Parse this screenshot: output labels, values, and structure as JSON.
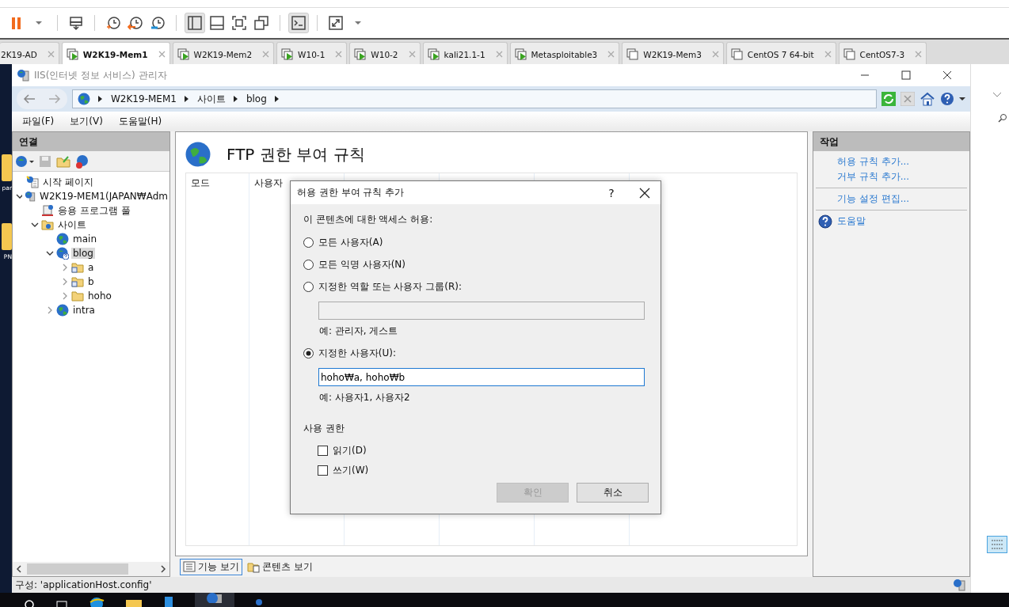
{
  "vm_tabs": [
    {
      "label": "2K19-AD",
      "selected": false
    },
    {
      "label": "W2K19-Mem1",
      "selected": true,
      "running": true
    },
    {
      "label": "W2K19-Mem2",
      "selected": false,
      "running": true
    },
    {
      "label": "W10-1",
      "selected": false,
      "running": true
    },
    {
      "label": "W10-2",
      "selected": false,
      "running": true
    },
    {
      "label": "kali21.1-1",
      "selected": false,
      "running": true
    },
    {
      "label": "Metasploitable3",
      "selected": false,
      "running": true
    },
    {
      "label": "W2K19-Mem3",
      "selected": false,
      "running": false
    },
    {
      "label": "CentOS 7 64-bit",
      "selected": false,
      "running": false
    },
    {
      "label": "CentOS7-3",
      "selected": false,
      "running": false
    }
  ],
  "desktop_labels": [
    "par",
    "PN"
  ],
  "iis": {
    "title": "IIS(인터넷 정보 서비스) 관리자",
    "breadcrumb": [
      "W2K19-MEM1",
      "사이트",
      "blog"
    ],
    "menu": [
      "파일(F)",
      "보기(V)",
      "도움말(H)"
    ],
    "connections": {
      "title": "연결",
      "tree": [
        {
          "label": "시작 페이지",
          "kind": "start",
          "selected": false
        },
        {
          "label": "W2K19-MEM1(JAPAN₩Adm",
          "kind": "server",
          "selected": false,
          "expanded": true,
          "children": [
            {
              "label": "응용 프로그램 풀",
              "kind": "pool",
              "selected": false
            },
            {
              "label": "사이트",
              "kind": "sites",
              "selected": false,
              "expanded": true,
              "children": [
                {
                  "label": "main",
                  "kind": "site",
                  "selected": false
                },
                {
                  "label": "blog",
                  "kind": "site_alert",
                  "selected": true,
                  "expanded": true,
                  "children": [
                    {
                      "label": "a",
                      "kind": "vdir",
                      "selected": false,
                      "expanded": false
                    },
                    {
                      "label": "b",
                      "kind": "vdir",
                      "selected": false,
                      "expanded": false
                    },
                    {
                      "label": "hoho",
                      "kind": "folder",
                      "selected": false,
                      "expanded": false
                    }
                  ]
                },
                {
                  "label": "intra",
                  "kind": "site",
                  "selected": false,
                  "expanded": false
                }
              ]
            }
          ]
        }
      ]
    },
    "feature": {
      "title": "FTP 권한 부여 규칙",
      "columns": [
        "모드",
        "사용자"
      ]
    },
    "views": [
      {
        "label": "기능 보기",
        "selected": true
      },
      {
        "label": "콘텐츠 보기",
        "selected": false
      }
    ],
    "actions": {
      "title": "작업",
      "groups": [
        [
          {
            "label": "허용 규칙 추가...",
            "kind": "link"
          },
          {
            "label": "거부 규칙 추가...",
            "kind": "link"
          }
        ],
        [
          {
            "label": "기능 설정 편집...",
            "kind": "link"
          }
        ],
        [
          {
            "label": "도움말",
            "kind": "help"
          }
        ]
      ]
    },
    "status": "구성: 'applicationHost.config'"
  },
  "dialog": {
    "title": "허용 권한 부여 규칙 추가",
    "help": "?",
    "prompt": "이 콘텐츠에 대한 액세스 허용:",
    "options": [
      {
        "label": "모든 사용자(A)",
        "selected": false
      },
      {
        "label": "모든 익명 사용자(N)",
        "selected": false
      },
      {
        "label": "지정한 역할 또는 사용자 그룹(R):",
        "selected": false,
        "field": {
          "disabled": true
        },
        "example": "예: 관리자, 게스트"
      },
      {
        "label": "지정한 사용자(U):",
        "selected": true,
        "field": {
          "value": "hoho₩a, hoho₩b",
          "disabled": false
        },
        "example": "예: 사용자1, 사용자2"
      }
    ],
    "permissions_title": "사용 권한",
    "permissions": [
      {
        "label": "읽기(D)",
        "checked": false
      },
      {
        "label": "쓰기(W)",
        "checked": false
      }
    ],
    "buttons": [
      {
        "label": "확인",
        "disabled": true
      },
      {
        "label": "취소",
        "disabled": false
      }
    ]
  }
}
